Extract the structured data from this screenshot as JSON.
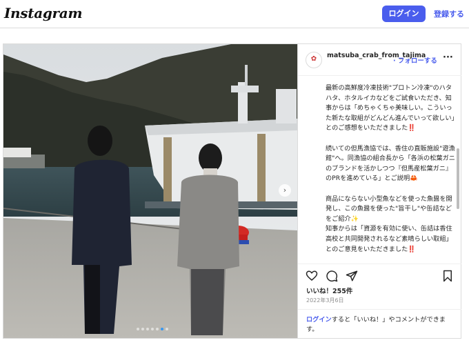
{
  "header": {
    "logo": "Instagram",
    "login_button": "ログイン",
    "signup_link": "登録する"
  },
  "post": {
    "username": "matsuba_crab_from_tajima",
    "follow": "フォローする",
    "more_icon": "more-horizontal-icon",
    "caption": "最新の高鮮度冷凍技術\"プロトン冷凍\"のハタハタ、ホタルイカなどをご試食いただき、知事からは「めちゃくちゃ美味しい。こういった新たな取組がどんどん進んでいって欲しい」とのご感想をいただきました‼️\n\n続いての但馬漁協では、香住の直販施設\"遊漁館\"へ。同漁協の組合長から「各浜の松葉ガニのブランドを活かしつつ『但馬産松葉ガニ』のPRを進めている」とご説明🦀\n\n商品にならない小型魚などを使った魚醤を開発し、この魚醤を使った\"旨干し\"や缶詰などをご紹介✨\n知事からは「資源を有効に使い、缶詰は香住高校と共同開発されるなど素晴らしい取組」とのご意見をいただきました‼️",
    "likes": "いいね！255件",
    "date": "2022年3月6日",
    "login_prompt_link": "ログイン",
    "login_prompt_rest": "すると「いいね！」やコメントができます。",
    "carousel": {
      "count": 7,
      "active": 5
    },
    "icons": [
      "heart-icon",
      "comment-icon",
      "share-icon",
      "bookmark-icon"
    ],
    "colors": {
      "accent": "#4a5ded",
      "active_dot": "#3797f0"
    }
  }
}
